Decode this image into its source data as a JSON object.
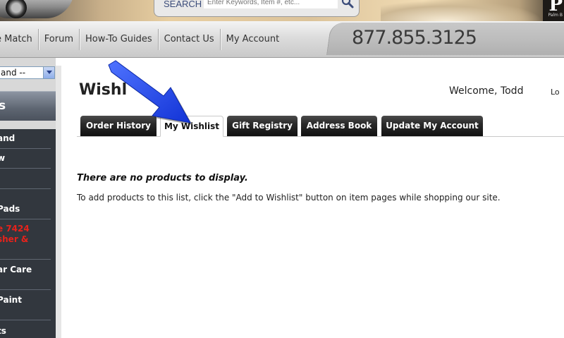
{
  "header": {
    "search": {
      "label": "SEARCH",
      "placeholder": "Enter Keywords, Item #, etc..."
    },
    "logo_letter": "P",
    "logo_sub": "Palm B"
  },
  "nav": {
    "items": [
      {
        "label": "e Match"
      },
      {
        "label": "Forum"
      },
      {
        "label": "How-To Guides"
      },
      {
        "label": "Contact Us"
      },
      {
        "label": "My Account"
      }
    ],
    "phone": "877.855.3125"
  },
  "sidebar": {
    "brand_select_value": "and --",
    "category_header": "s",
    "items": [
      {
        "label": "and",
        "red": false
      },
      {
        "label": "w",
        "red": false
      },
      {
        "label": "",
        "red": false
      },
      {
        "label": ",\nPads",
        "red": false
      },
      {
        "label": "e 7424\nsher &",
        "red": true
      },
      {
        "label": "ar Care",
        "red": false
      },
      {
        "label": "Paint",
        "red": false
      },
      {
        "label": "ts",
        "red": false
      }
    ]
  },
  "main": {
    "title": "Wishl",
    "welcome": "Welcome, Todd",
    "logout": "Lo",
    "tabs": [
      {
        "label": "Order History",
        "active": false
      },
      {
        "label": "My Wishlist",
        "active": true
      },
      {
        "label": "Gift Registry",
        "active": false
      },
      {
        "label": "Address Book",
        "active": false
      },
      {
        "label": "Update My Account",
        "active": false
      }
    ],
    "empty_title": "There are no products to display.",
    "empty_desc": "To add products to this list, click the \"Add to Wishlist\" button on item pages while shopping our site."
  },
  "colors": {
    "arrow": "#1f45e6",
    "sidebar_bg": "#32373e",
    "tab_bg": "#1b1b1b",
    "red_link": "#e8221b"
  },
  "icons": {
    "search": "magnifier-icon",
    "dropdown": "chevron-down-icon",
    "pointer": "blue-arrow-icon"
  }
}
